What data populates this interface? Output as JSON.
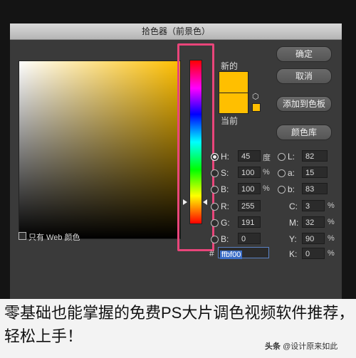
{
  "dialog": {
    "title": "拾色器（前景色）",
    "new_label": "新的",
    "current_label": "当前",
    "web_only_label": "只有 Web 颜色",
    "colors": {
      "selected": "#ffbf00",
      "highlight": "#e9457a"
    },
    "buttons": {
      "ok": "确定",
      "cancel": "取消",
      "add_swatch": "添加到色板",
      "library": "颜色库"
    },
    "hsb": {
      "h": {
        "label": "H:",
        "value": "45",
        "unit": "度"
      },
      "s": {
        "label": "S:",
        "value": "100",
        "unit": "%"
      },
      "b": {
        "label": "B:",
        "value": "100",
        "unit": "%"
      }
    },
    "rgb": {
      "r": {
        "label": "R:",
        "value": "255"
      },
      "g": {
        "label": "G:",
        "value": "191"
      },
      "b": {
        "label": "B:",
        "value": "0"
      }
    },
    "lab": {
      "l": {
        "label": "L:",
        "value": "82"
      },
      "a": {
        "label": "a:",
        "value": "15"
      },
      "b": {
        "label": "b:",
        "value": "83"
      }
    },
    "cmyk": {
      "c": {
        "label": "C:",
        "value": "3",
        "unit": "%"
      },
      "m": {
        "label": "M:",
        "value": "32",
        "unit": "%"
      },
      "y": {
        "label": "Y:",
        "value": "90",
        "unit": "%"
      },
      "k": {
        "label": "K:",
        "value": "0",
        "unit": "%"
      }
    },
    "hex": {
      "label": "#",
      "value": "ffbf00"
    }
  },
  "caption": "零基础也能掌握的免费PS大片调色视频软件推荐，轻松上手！",
  "footer": {
    "brand": "头条",
    "author": "@设计原来如此"
  }
}
